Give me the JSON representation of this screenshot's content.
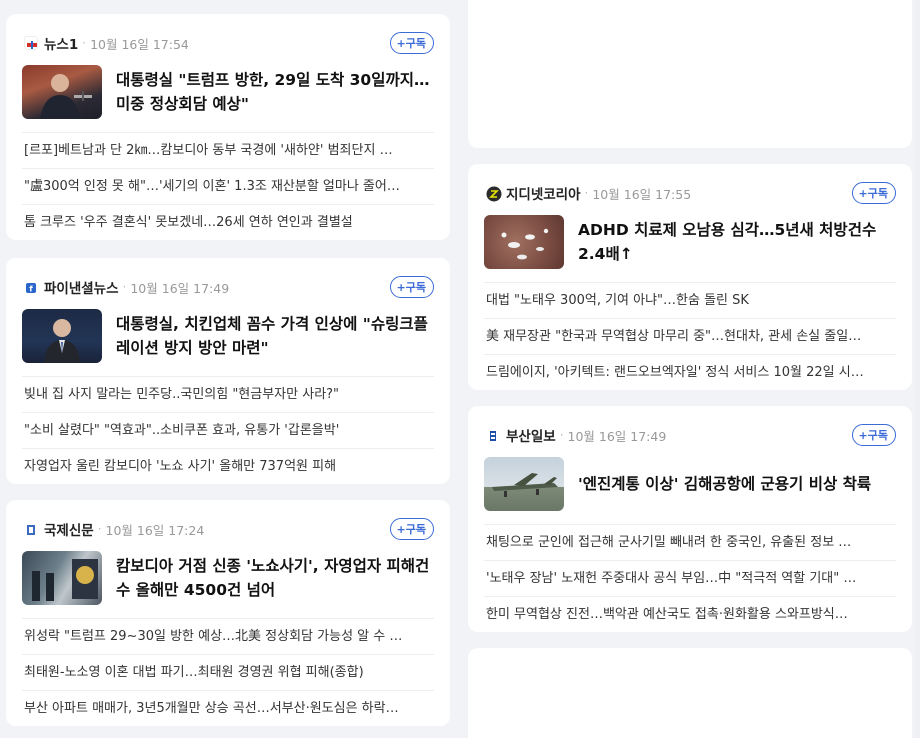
{
  "subscribe_label": "+구독",
  "cards": [
    {
      "press": "뉴스1",
      "time": "10월 16일 17:54",
      "headline": "대통령실 \"트럼프 방한, 29일 도착 30일까지…미중 정상회담 예상\"",
      "items": [
        "[르포]베트남과 단 2㎞…캄보디아 동부 국경에 '새하얀' 범죄단지 …",
        "\"盧300억 인정 못 해\"…'세기의 이혼' 1.3조 재산분할 얼마나 줄어…",
        "톰 크루즈 '우주 결혼식' 못보겠네…26세 연하 연인과 결별설"
      ]
    },
    {
      "press": "파이낸셜뉴스",
      "time": "10월 16일 17:49",
      "headline": "대통령실, 치킨업체 꼼수 가격 인상에 \"슈링크플레이션 방지 방안 마련\"",
      "items": [
        "빚내 집 사지 말라는 민주당..국민의힘 \"현금부자만 사라?\"",
        "\"소비 살렸다\" \"역효과\"..소비쿠폰 효과, 유통가 '갑론을박'",
        "자영업자 울린 캄보디아 '노쇼 사기' 올해만 737억원 피해"
      ]
    },
    {
      "press": "국제신문",
      "time": "10월 16일 17:24",
      "headline": "캄보디아 거점 신종 '노쇼사기', 자영업자 피해건수 올해만 4500건 넘어",
      "items": [
        "위성락 \"트럼프 29~30일 방한 예상…北美 정상회담 가능성 알 수 …",
        "최태원-노소영 이혼 대법 파기…최태원 경영권 위협 피해(종합)",
        "부산 아파트 매매가, 3년5개월만 상승 곡선…서부산·원도심은 하락…"
      ]
    },
    {
      "press": "지디넷코리아",
      "time": "10월 16일 17:55",
      "headline": "ADHD 치료제 오남용 심각…5년새 처방건수 2.4배↑",
      "items": [
        "대법 \"노태우 300억, 기여 아냐\"…한숨 돌린 SK",
        "美 재무장관 \"한국과 무역협상 마무리 중\"…현대차, 관세 손실 줄일…",
        "드림에이지, '아키텍트: 랜드오브엑자일' 정식 서비스 10월 22일 시…"
      ]
    },
    {
      "press": "부산일보",
      "time": "10월 16일 17:49",
      "headline": "'엔진계통 이상' 김해공항에 군용기 비상 착륙",
      "items": [
        "채팅으로 군인에 접근해 군사기밀 빼내려 한 중국인, 유출된 정보 …",
        "'노태우 장남' 노재헌 주중대사 공식 부임…中 \"적극적 역할 기대\" …",
        "한미 무역협상 진전…백악관 예산국도 접촉·원화활용 스와프방식…"
      ]
    }
  ],
  "colors": {
    "accent": "#3a6bd6",
    "logo_news1": "#d62d2d",
    "logo_fn": "#2a66c9",
    "logo_kookje": "#3b6bbf",
    "logo_zdnet": "#2b2b2b",
    "logo_busan": "#1e4fa6"
  }
}
